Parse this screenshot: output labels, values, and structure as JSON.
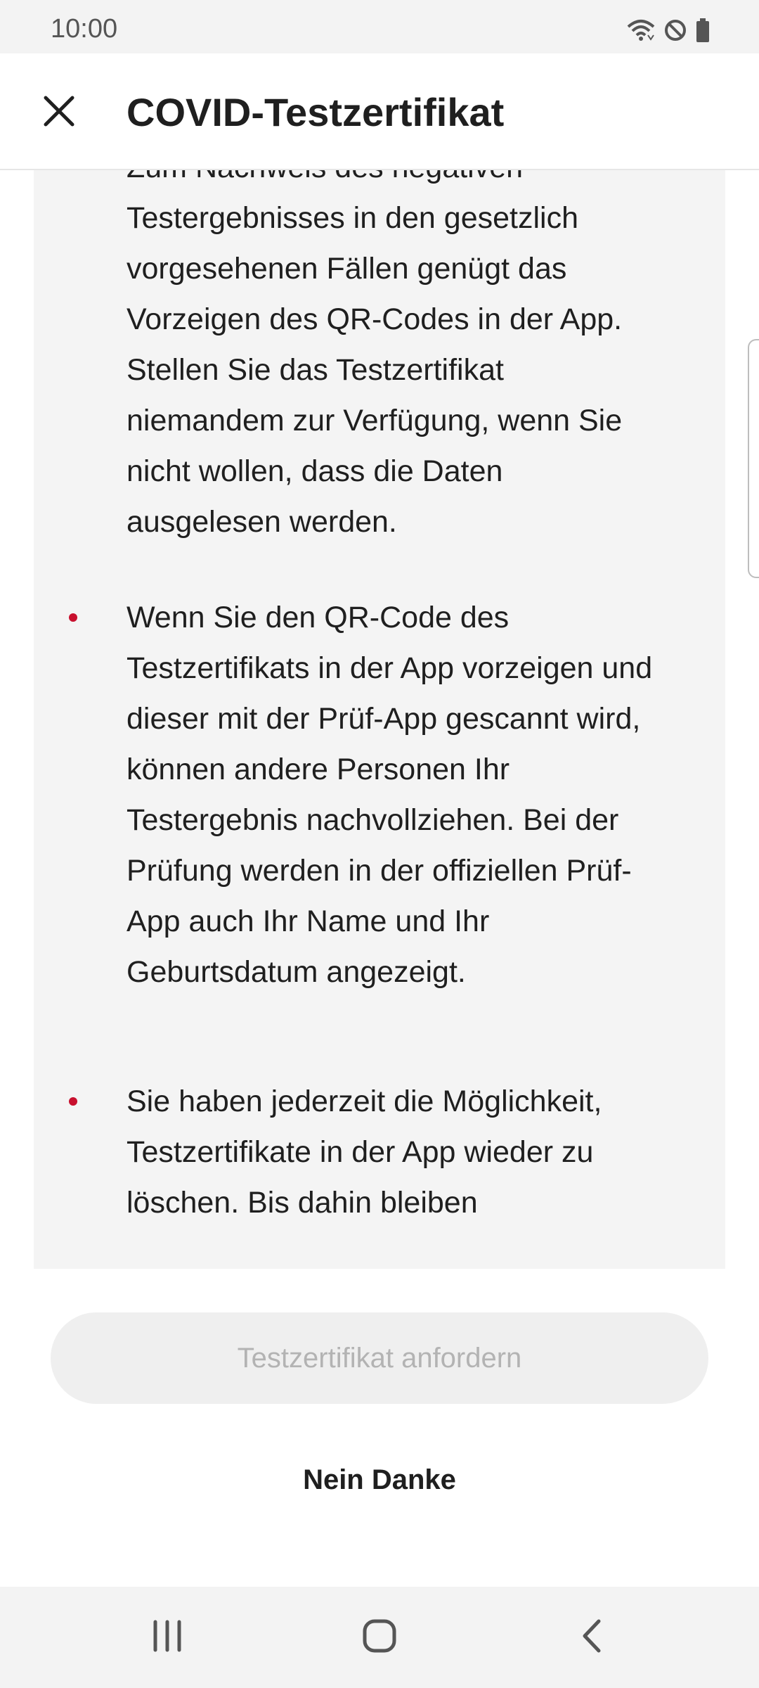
{
  "status_bar": {
    "time": "10:00",
    "icons": [
      "wifi-icon",
      "do-not-disturb-icon",
      "battery-icon"
    ]
  },
  "header": {
    "title": "COVID-Testzertifikat",
    "close_icon": "close-icon"
  },
  "content": {
    "paragraphs": [
      {
        "bullet": false,
        "text": "Zum Nachweis des negativen Testergebnisses in den gesetzlich vorgesehenen Fällen genügt das Vorzeigen des QR-Codes in der App. Stellen Sie das Testzertifikat niemandem zur Verfügung, wenn Sie nicht wollen, dass die Daten ausgelesen werden."
      },
      {
        "bullet": true,
        "text": "Wenn Sie den QR-Code des Testzertifikats in der App vorzeigen und dieser mit der Prüf-App gescannt wird, können andere Personen Ihr Testergebnis nachvollziehen. Bei der Prüfung werden in der offiziellen Prüf-App auch Ihr Name und Ihr Geburtsdatum angezeigt."
      },
      {
        "bullet": true,
        "text": "Sie haben jederzeit die Möglichkeit, Testzertifikate in der App wieder zu löschen. Bis dahin bleiben"
      }
    ]
  },
  "actions": {
    "request_label": "Testzertifikat anfordern",
    "decline_label": "Nein Danke"
  },
  "colors": {
    "bullet": "#c8102e",
    "content_background": "#f4f4f4",
    "disabled_button_bg": "#efefef",
    "disabled_button_text": "#b3b3b3"
  },
  "nav_bar": {
    "icons": [
      "recent-apps-icon",
      "home-icon",
      "back-icon"
    ]
  }
}
